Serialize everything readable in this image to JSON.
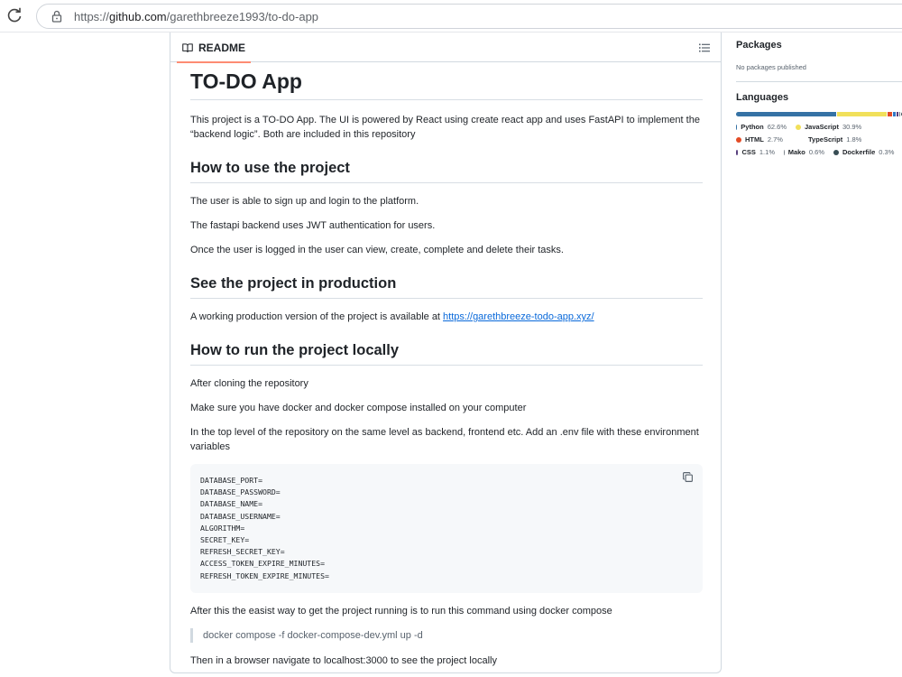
{
  "browser": {
    "url_prefix": "https://",
    "url_host": "github.com",
    "url_path": "/garethbreeze1993/to-do-app"
  },
  "readme": {
    "tab_label": "README",
    "title": "TO-DO App",
    "intro": "This project is a TO-DO App. The UI is powered by React using create react app and uses FastAPI to implement the “backend logic”. Both are included in this repository",
    "how_to_use": {
      "heading": "How to use the project",
      "p1": "The user is able to sign up and login to the platform.",
      "p2": "The fastapi backend uses JWT authentication for users.",
      "p3": "Once the user is logged in the user can view, create, complete and delete their tasks."
    },
    "production": {
      "heading": "See the project in production",
      "text": "A working production version of the project is available at ",
      "link": "https://garethbreeze-todo-app.xyz/"
    },
    "run_locally": {
      "heading": "How to run the project locally",
      "p1": "After cloning the repository",
      "p2": "Make sure you have docker and docker compose installed on your computer",
      "p3": "In the top level of the repository on the same level as backend, frontend etc. Add an .env file with these environment variables",
      "code": "DATABASE_PORT=\nDATABASE_PASSWORD=\nDATABASE_NAME=\nDATABASE_USERNAME=\nALGORITHM=\nSECRET_KEY=\nREFRESH_SECRET_KEY=\nACCESS_TOKEN_EXPIRE_MINUTES=\nREFRESH_TOKEN_EXPIRE_MINUTES=",
      "p4": "After this the easist way to get the project running is to run this command using docker compose",
      "command": "docker compose -f docker-compose-dev.yml up -d",
      "p5": "Then in a browser navigate to localhost:3000 to see the project locally"
    }
  },
  "sidebar": {
    "packages_title": "Packages",
    "packages_text": "No packages published",
    "languages_title": "Languages",
    "languages": [
      {
        "name": "Python",
        "pct": "62.6%",
        "value": 62.6,
        "color": "#3572A5"
      },
      {
        "name": "JavaScript",
        "pct": "30.9%",
        "value": 30.9,
        "color": "#f1e05a"
      },
      {
        "name": "HTML",
        "pct": "2.7%",
        "value": 2.7,
        "color": "#e34c26"
      },
      {
        "name": "TypeScript",
        "pct": "1.8%",
        "value": 1.8,
        "color": "#3178c6"
      },
      {
        "name": "CSS",
        "pct": "1.1%",
        "value": 1.1,
        "color": "#563d7c"
      },
      {
        "name": "Mako",
        "pct": "0.6%",
        "value": 0.6,
        "color": "#7e858d"
      },
      {
        "name": "Dockerfile",
        "pct": "0.3%",
        "value": 0.3,
        "color": "#384d54"
      }
    ]
  }
}
